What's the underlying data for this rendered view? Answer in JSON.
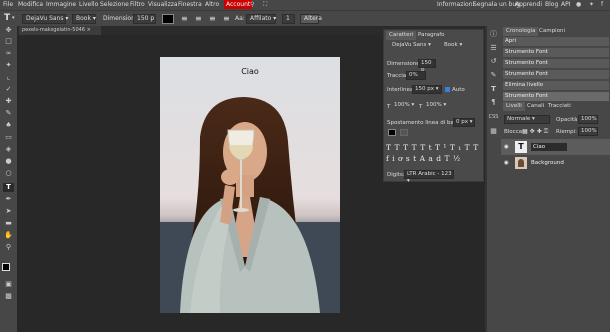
{
  "menu": {
    "items": [
      "File",
      "Modifica",
      "Immagine",
      "Livello",
      "Selezione",
      "Filtro",
      "Visualizza",
      "Finestra",
      "Altro"
    ],
    "account": "Account",
    "right_items": [
      "Informazioni",
      "Segnala un bug",
      "Apprendi",
      "Blog",
      "API"
    ]
  },
  "options": {
    "font": "DejaVu Sans",
    "style": "Book",
    "size_label": "Dimensione:",
    "size_value": "150 p",
    "aa_label": "Aa:",
    "aa_value": "Affilato",
    "count_value": "1",
    "altera": "Altera"
  },
  "document": {
    "tab_label": "pexels-maksgelatin-5046",
    "text": "Ciao"
  },
  "character_panel": {
    "tab_char": "Caratteri",
    "tab_para": "Paragrafo",
    "font": "DejaVu Sans",
    "style": "Book",
    "dim_label": "Dimensione:",
    "dim_value": "150 p",
    "traccia_label": "Traccia:",
    "traccia_value": "0%",
    "interlinea_label": "Interlinea:",
    "interlinea_value": "150 px",
    "auto_label": "Auto",
    "scale_v": "100%",
    "scale_h": "100%",
    "baseline_label": "Spostamento linea di base:",
    "baseline_value": "0 px",
    "cifre_label": "Digits:",
    "cifre_value": "LTR Arabic - 123"
  },
  "history": {
    "tab_history": "Cronologia",
    "tab_samples": "Campioni",
    "items": [
      "Apri",
      "Strumento Font",
      "Strumento Font",
      "Strumento Font",
      "Elimina livello",
      "Strumento Font"
    ]
  },
  "layers": {
    "tab_layers": "Livelli",
    "tab_channels": "Canali",
    "tab_paths": "Tracciati",
    "blend": "Normale",
    "opacity_label": "Opacità:",
    "opacity": "100%",
    "lock_label": "Blocca:",
    "fill_label": "Riempi:",
    "fill": "100%",
    "items": [
      {
        "name": "Ciao"
      },
      {
        "name": "Background"
      }
    ]
  }
}
